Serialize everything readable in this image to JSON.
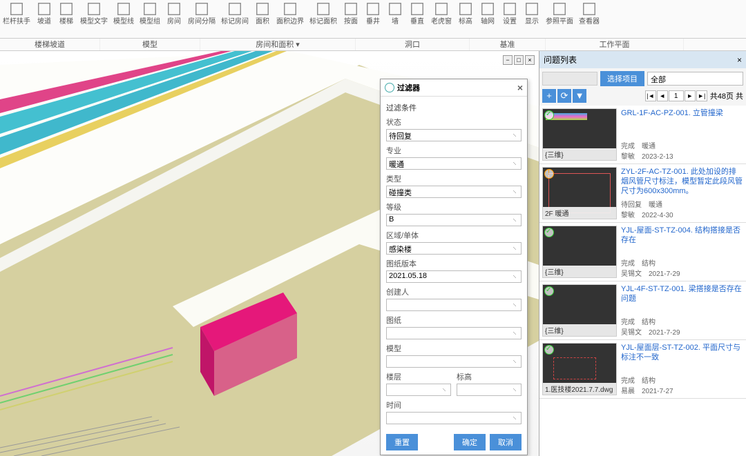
{
  "ribbon": {
    "items": [
      "栏杆扶手",
      "坡道",
      "楼梯",
      "模型文字",
      "模型线",
      "模型组",
      "房间",
      "房间分隔",
      "标记房间",
      "面积",
      "面积边界",
      "标记面积",
      "按面",
      "垂井",
      "墙",
      "垂直",
      "老虎窗",
      "标高",
      "轴网",
      "设置",
      "显示",
      "参照平面",
      "查看器"
    ],
    "groups": [
      "楼梯坡道",
      "模型",
      "房间和面积 ▾",
      "洞口",
      "基准",
      "工作平面"
    ]
  },
  "filter": {
    "title": "过滤器",
    "sect": "过滤条件",
    "fields": {
      "status_l": "状态",
      "status_v": "待回复",
      "disc_l": "专业",
      "disc_v": "暖通",
      "type_l": "类型",
      "type_v": "碰撞类",
      "grade_l": "等级",
      "grade_v": "B",
      "area_l": "区域/单体",
      "area_v": "感染楼",
      "ver_l": "图纸版本",
      "ver_v": "2021.05.18",
      "creator_l": "创建人",
      "creator_v": "",
      "dwg_l": "图纸",
      "dwg_v": "",
      "model_l": "模型",
      "model_v": "",
      "floor_l": "楼层",
      "height_l": "标高",
      "time_l": "时间"
    },
    "btn_reset": "重置",
    "btn_ok": "确定",
    "btn_cancel": "取消"
  },
  "panel": {
    "title": "问题列表",
    "tab": "选择项目",
    "dd": "全部",
    "page_info": "共48页 共",
    "page_cur": "1",
    "items": [
      {
        "title": "GRL-1F-AC-PZ-001. 立管撞梁",
        "status": "完成",
        "disc": "暖通",
        "author": "黎敏",
        "date": "2023-2-13",
        "cap": "{三维}",
        "thumb": "thumb-1",
        "chk": "done"
      },
      {
        "title": "ZYL-2F-AC-TZ-001. 此处加设的排烟风管尺寸标注，模型暂定此段风管尺寸为600x300mm。",
        "status": "待回复",
        "disc": "暖通",
        "author": "黎敏",
        "date": "2022-4-30",
        "cap": "2F 暖通",
        "thumb": "thumb-2",
        "chk": "pending"
      },
      {
        "title": "YJL-屋面-ST-TZ-004. 结构搭接是否存在",
        "status": "完成",
        "disc": "结构",
        "author": "吴锡文",
        "date": "2021-7-29",
        "cap": "{三维}",
        "thumb": "thumb-3",
        "chk": "done"
      },
      {
        "title": "YJL-4F-ST-TZ-001. 梁搭接是否存在问题",
        "status": "完成",
        "disc": "结构",
        "author": "吴锡文",
        "date": "2021-7-29",
        "cap": "{三维}",
        "thumb": "thumb-4",
        "chk": "done"
      },
      {
        "title": "YJL-屋面层-ST-TZ-002. 平面尺寸与标注不一致",
        "status": "完成",
        "disc": "结构",
        "author": "易晨",
        "date": "2021-7-27",
        "cap": "1.医技楼2021.7.7.dwg",
        "thumb": "thumb-5",
        "chk": "done"
      }
    ]
  }
}
